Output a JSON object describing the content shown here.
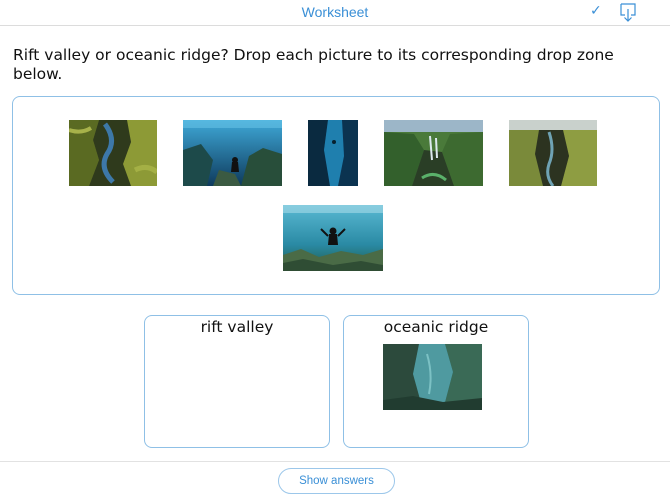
{
  "header": {
    "title": "Worksheet",
    "check_icon": "check-icon",
    "download_icon": "download-icon",
    "accent": "#3a8fd6"
  },
  "prompt": "Rift valley or oceanic ridge? Drop each picture to its corresponding drop zone below.",
  "pictures": [
    {
      "name": "canyon-moss-picture",
      "description": "green mossy canyon with river"
    },
    {
      "name": "diver-rift-picture",
      "description": "diver in clear blue underwater fissure"
    },
    {
      "name": "underwater-fissure-picture",
      "description": "dark blue underwater crack"
    },
    {
      "name": "green-canyon-waterfall-picture",
      "description": "green canyon with waterfalls"
    },
    {
      "name": "mossy-gorge-picture",
      "description": "mossy gorge seen from above"
    },
    {
      "name": "diver-surface-picture",
      "description": "diver floating over rocks under surface"
    },
    {
      "name": "placed-underwater-canyon-picture",
      "description": "underwater canyon wall, placed in oceanic ridge zone"
    }
  ],
  "drop_zones": [
    {
      "label": "rift valley"
    },
    {
      "label": "oceanic ridge"
    }
  ],
  "footer": {
    "show_answers_label": "Show answers"
  }
}
